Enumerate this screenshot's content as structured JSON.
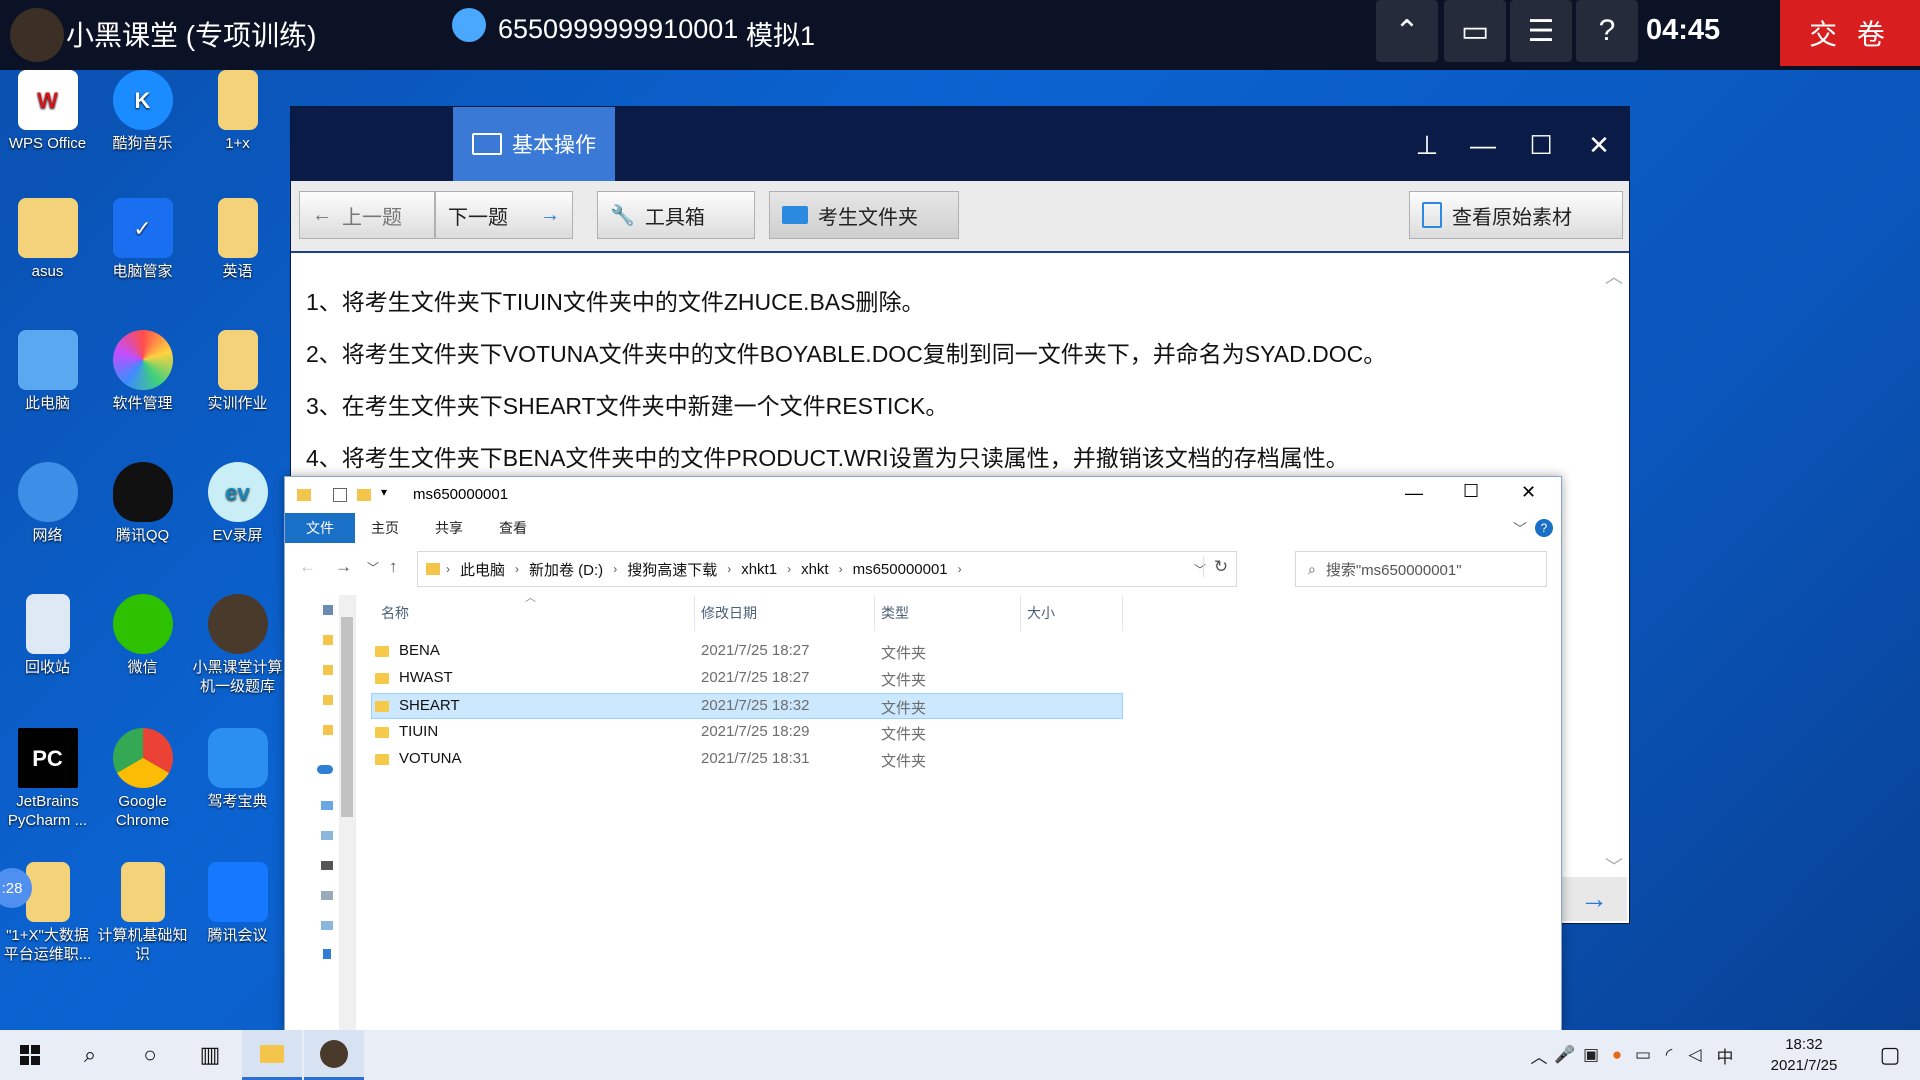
{
  "topbar": {
    "app_title": "小黑课堂 (专项训练)",
    "user_id": "6550999999910001",
    "mode": "模拟1",
    "timer": "04:45",
    "submit_label": "交 卷",
    "tools": [
      "collapse-icon",
      "window-icon",
      "list-icon",
      "help-icon"
    ],
    "help_glyph": "?"
  },
  "desktop": {
    "icons": [
      {
        "label": "WPS Office",
        "icon": "wps-icon"
      },
      {
        "label": "酷狗音乐",
        "icon": "kugou-icon"
      },
      {
        "label": "1+x",
        "icon": "folder-icon"
      },
      {
        "label": "asus",
        "icon": "user-folder-icon"
      },
      {
        "label": "电脑管家",
        "icon": "shield-icon"
      },
      {
        "label": "英语",
        "icon": "folder-icon"
      },
      {
        "label": "此电脑",
        "icon": "computer-icon"
      },
      {
        "label": "软件管理",
        "icon": "software-icon"
      },
      {
        "label": "实训作业",
        "icon": "folder-icon"
      },
      {
        "label": "网络",
        "icon": "network-icon"
      },
      {
        "label": "腾讯QQ",
        "icon": "qq-icon"
      },
      {
        "label": "EV录屏",
        "icon": "ev-icon"
      },
      {
        "label": "回收站",
        "icon": "recycle-bin-icon"
      },
      {
        "label": "微信",
        "icon": "wechat-icon"
      },
      {
        "label": "小黑课堂计算机一级题库",
        "icon": "xiaohei-icon"
      },
      {
        "label": "JetBrains PyCharm ...",
        "icon": "pycharm-icon"
      },
      {
        "label": "Google Chrome",
        "icon": "chrome-icon"
      },
      {
        "label": "驾考宝典",
        "icon": "car-icon"
      },
      {
        "label": "\"1+X\"大数据平台运维职...",
        "icon": "folder-icon"
      },
      {
        "label": "计算机基础知识",
        "icon": "folder-icon"
      },
      {
        "label": "腾讯会议",
        "icon": "meeting-icon"
      }
    ],
    "float_badge": ":28"
  },
  "exam_window": {
    "tab_label": "基本操作",
    "toolbar": {
      "prev_label": "上一题",
      "next_label": "下一题",
      "toolbox_label": "工具箱",
      "folder_label": "考生文件夹",
      "material_label": "查看原始素材"
    },
    "questions": [
      "1、将考生文件夹下TIUIN文件夹中的文件ZHUCE.BAS删除。",
      "2、将考生文件夹下VOTUNA文件夹中的文件BOYABLE.DOC复制到同一文件夹下，并命名为SYAD.DOC。",
      "3、在考生文件夹下SHEART文件夹中新建一个文件RESTICK。",
      "4、将考生文件夹下BENA文件夹中的文件PRODUCT.WRI设置为只读属性，并撤销该文档的存档属性。"
    ]
  },
  "explorer": {
    "title": "ms650000001",
    "ribbon_tabs": [
      "文件",
      "主页",
      "共享",
      "查看"
    ],
    "breadcrumb": [
      "此电脑",
      "新加卷 (D:)",
      "搜狗高速下载",
      "xhkt1",
      "xhkt",
      "ms650000001"
    ],
    "search_placeholder": "搜索\"ms650000001\"",
    "columns": [
      "名称",
      "修改日期",
      "类型",
      "大小"
    ],
    "files": [
      {
        "name": "BENA",
        "date": "2021/7/25 18:27",
        "type": "文件夹",
        "selected": false
      },
      {
        "name": "HWAST",
        "date": "2021/7/25 18:27",
        "type": "文件夹",
        "selected": false
      },
      {
        "name": "SHEART",
        "date": "2021/7/25 18:32",
        "type": "文件夹",
        "selected": true
      },
      {
        "name": "TIUIN",
        "date": "2021/7/25 18:29",
        "type": "文件夹",
        "selected": false
      },
      {
        "name": "VOTUNA",
        "date": "2021/7/25 18:31",
        "type": "文件夹",
        "selected": false
      }
    ]
  },
  "taskbar": {
    "time": "18:32",
    "date": "2021/7/25",
    "ime": "中"
  },
  "colors": {
    "desktop_blue": "#0b63d1",
    "topbar": "#0b1226",
    "submit_red": "#d81e1e",
    "exam_title": "#0b1b47",
    "exam_tab": "#3a7ad6",
    "selection": "#cce8ff"
  }
}
